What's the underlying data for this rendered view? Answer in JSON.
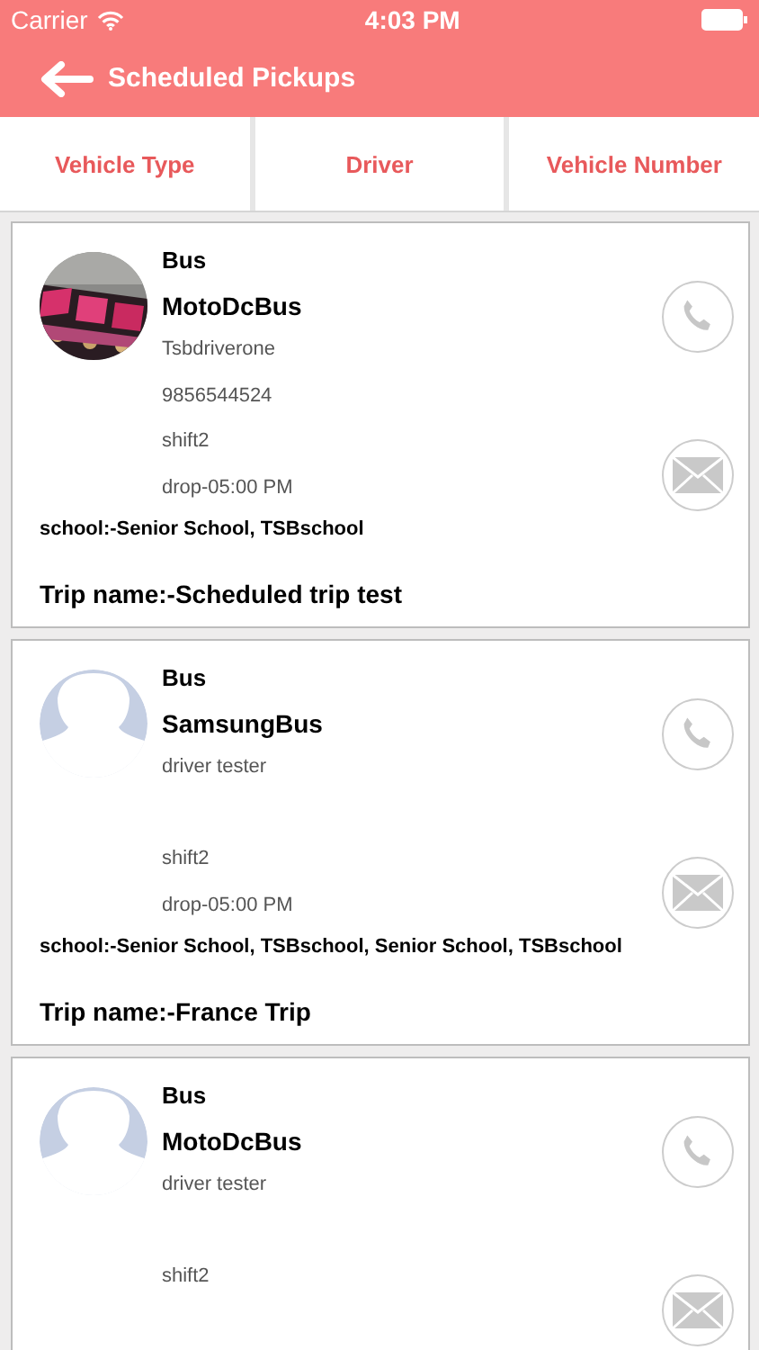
{
  "status_bar": {
    "carrier": "Carrier",
    "time": "4:03 PM"
  },
  "header": {
    "title": "Scheduled Pickups"
  },
  "columns": [
    "Vehicle Type",
    "Driver",
    "Vehicle Number"
  ],
  "pickups": [
    {
      "vehicle_type": "Bus",
      "vehicle": "MotoDcBus",
      "driver": "Tsbdriverone",
      "phone": "9856544524",
      "shift": "shift2",
      "drop": "drop-05:00 PM",
      "school": "school:-Senior School, TSBschool",
      "trip": "Trip name:-Scheduled trip test"
    },
    {
      "kind": "placeholder",
      "vehicle_type": "Bus",
      "vehicle": "SamsungBus",
      "driver": "driver tester",
      "shift": "shift2",
      "drop": "drop-05:00 PM",
      "school": "school:-Senior School, TSBschool, Senior School, TSBschool",
      "trip": "Trip name:-France Trip"
    },
    {
      "kind": "placeholder",
      "vehicle_type": "Bus",
      "vehicle": "MotoDcBus",
      "driver": "driver tester",
      "shift": "shift2"
    }
  ]
}
